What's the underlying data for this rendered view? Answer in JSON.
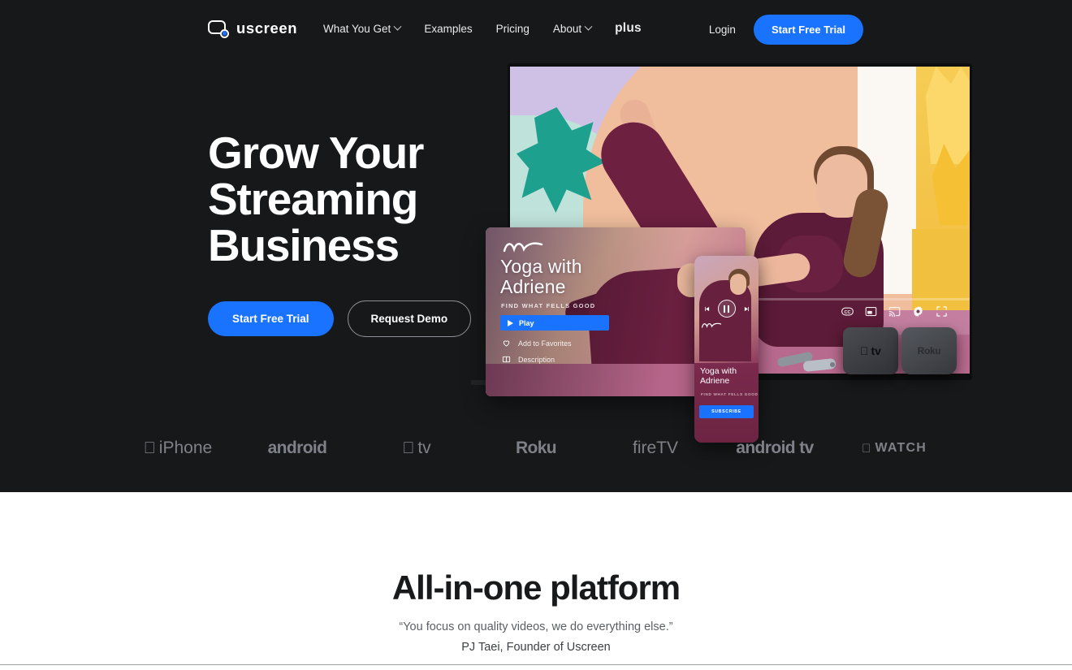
{
  "nav": {
    "logo_text": "uscreen",
    "logo_icon": "uscreen-logo-icon",
    "links": [
      {
        "label": "What You Get",
        "has_chevron": true
      },
      {
        "label": "Examples",
        "has_chevron": false
      },
      {
        "label": "Pricing",
        "has_chevron": false
      },
      {
        "label": "About",
        "has_chevron": true
      },
      {
        "label": "plus",
        "has_chevron": false
      }
    ],
    "login_label": "Login",
    "cta_label": "Start Free Trial"
  },
  "hero": {
    "title_line1": "Grow Your",
    "title_line2": "Streaming",
    "title_line3": "Business",
    "primary_cta": "Start Free Trial",
    "secondary_cta": "Request Demo"
  },
  "tv_card": {
    "title_line1": "Yoga with",
    "title_line2": "Adriene",
    "subtitle": "FIND WHAT FELLS GOOD",
    "play_label": "Play",
    "favorites_label": "Add to Favorites",
    "description_label": "Description"
  },
  "phone_card": {
    "title_line1": "Yoga with",
    "title_line2": "Adriene",
    "subtitle": "FIND WHAT FELLS GOOD",
    "subscribe_label": "SUBSCRIBE"
  },
  "player_controls": [
    "closed-captions-icon",
    "picture-in-picture-icon",
    "cast-icon",
    "settings-gear-icon",
    "fullscreen-icon"
  ],
  "devices": [
    {
      "name": "fire-tv-stick",
      "label": ""
    },
    {
      "name": "apple-tv-box",
      "label": "tv"
    },
    {
      "name": "roku-box",
      "label": "Roku"
    }
  ],
  "platforms": [
    {
      "icon": "apple-icon",
      "label": "iPhone",
      "style": "thin"
    },
    {
      "icon": "",
      "label": "android",
      "style": "bold"
    },
    {
      "icon": "apple-icon",
      "label": "tv",
      "style": "thin"
    },
    {
      "icon": "",
      "label": "Roku",
      "style": "bold"
    },
    {
      "icon": "",
      "label": "fireTV",
      "style": "thin"
    },
    {
      "icon": "",
      "label": "android tv",
      "style": "bold"
    },
    {
      "icon": "apple-icon",
      "label": "WATCH",
      "style": "watch"
    }
  ],
  "all_in_one": {
    "title": "All-in-one platform",
    "quote": "“You focus on quality videos, we do everything else.”",
    "attribution": "PJ Taei, Founder of Uscreen"
  },
  "colors": {
    "dark_bg": "#16181a",
    "accent_blue": "#1a73ff",
    "white_bg": "#ffffff",
    "muted_text": "#7e8288"
  }
}
